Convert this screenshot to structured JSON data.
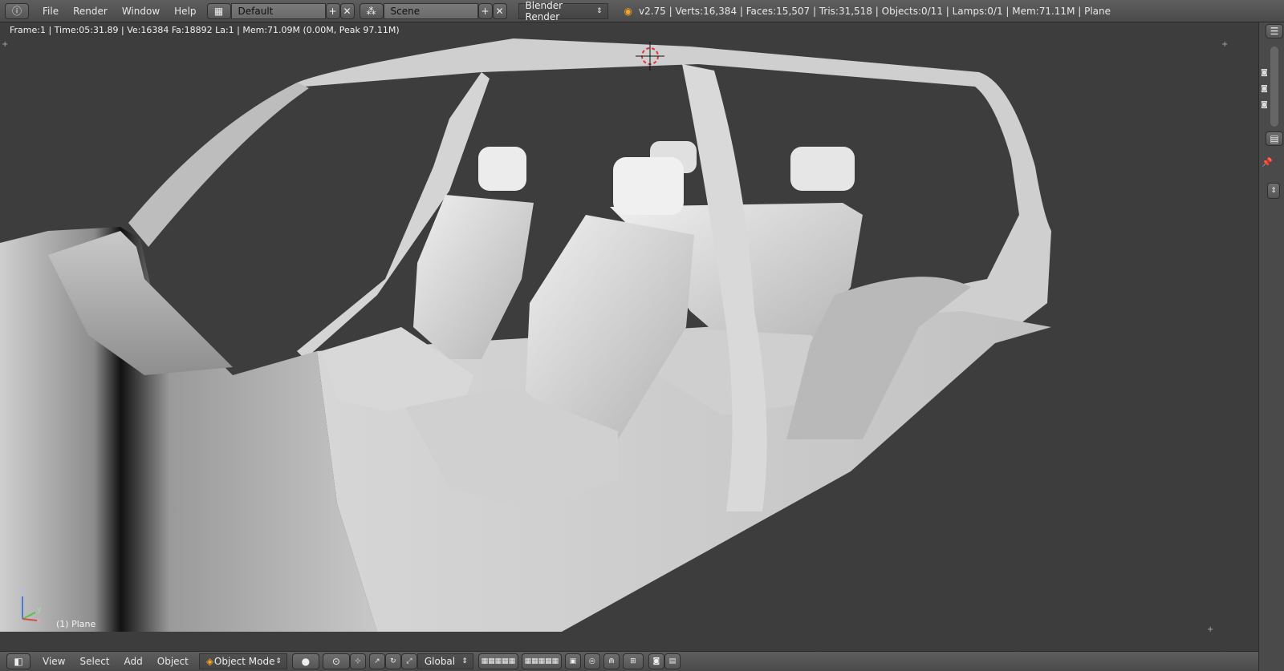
{
  "topbar": {
    "menus": [
      "File",
      "Render",
      "Window",
      "Help"
    ],
    "layout_value": "Default",
    "scene_value": "Scene",
    "engine_value": "Blender Render",
    "stats": "v2.75 | Verts:16,384 | Faces:15,507 | Tris:31,518 | Objects:0/11 | Lamps:0/1 | Mem:71.11M | Plane"
  },
  "viewport": {
    "header_info": "Frame:1 | Time:05:31.89 | Ve:16384 Fa:18892 La:1 | Mem:71.09M (0.00M, Peak 97.11M)",
    "object_label": "(1) Plane",
    "axis_z": "z",
    "axis_y": "y",
    "axis_x": "x"
  },
  "bottombar": {
    "menus": [
      "View",
      "Select",
      "Add",
      "Object"
    ],
    "mode_value": "Object Mode",
    "orientation_value": "Global"
  },
  "colors": {
    "header_bg": "#4f4f4f",
    "viewport_bg": "#3d3d3d",
    "mesh_light": "#e2e2e2",
    "mesh_mid": "#bdbdbd",
    "mesh_dark": "#8a8a8a"
  }
}
